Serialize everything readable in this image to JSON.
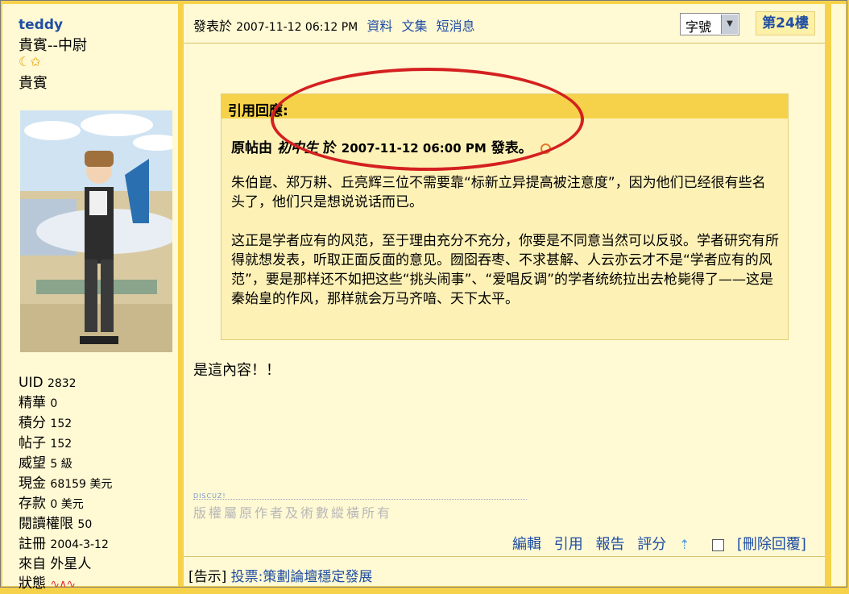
{
  "user": {
    "name": "teddy",
    "rank": "貴賓--中尉",
    "rank_icons": "☾✩",
    "group": "貴賓",
    "stats": [
      {
        "label": "UID",
        "value": "2832"
      },
      {
        "label": "精華",
        "value": "0"
      },
      {
        "label": "積分",
        "value": "152"
      },
      {
        "label": "帖子",
        "value": "152"
      },
      {
        "label": "威望",
        "value": "5 級"
      },
      {
        "label": "現金",
        "value": "68159 美元"
      },
      {
        "label": "存款",
        "value": "0 美元"
      },
      {
        "label": "閱讀權限",
        "value": "50"
      },
      {
        "label": "註冊",
        "value": "2004-3-12"
      },
      {
        "label": "來自",
        "value": "外星人"
      },
      {
        "label": "狀態",
        "value": ""
      }
    ]
  },
  "post": {
    "meta_prefix": "發表於",
    "date": "2007-11-12 06:12 PM",
    "links": [
      "資料",
      "文集",
      "短消息"
    ],
    "font_select": "字號",
    "floor": "第24樓",
    "quote": {
      "title": "引用回應:",
      "source_prefix": "原帖由",
      "source_user": "初中生",
      "source_mid": "於",
      "source_date": "2007-11-12 06:00 PM",
      "source_suffix": "發表。",
      "paragraph1": "朱伯崑、郑万耕、丘亮辉三位不需要靠“标新立异提高被注意度”，因为他们已经很有些名头了，他们只是想说说话而已。",
      "paragraph2": "这正是学者应有的风范，至于理由充分不充分，你要是不同意当然可以反驳。学者研究有所得就想发表，听取正面反面的意见。囫囵吞枣、不求甚解、人云亦云才不是“学者应有的风范”，要是那样还不如把这些“挑头闹事”、“爱唱反调”的学者统统拉出去枪毙得了——这是秦始皇的作风，那样就会万马齐喑、天下太平。"
    },
    "reply": "是這內容！！",
    "discuz_tag": "DISCUZ!",
    "copyright": "版權屬原作者及術數縱橫所有",
    "actions": [
      "編輯",
      "引用",
      "報告",
      "評分"
    ],
    "delete_label": "[刪除回覆]"
  },
  "footer": {
    "prefix": "[告示]",
    "link": "投票:策劃論壇穩定發展"
  },
  "colors": {
    "frame": "#f6d24a",
    "panel": "#fff9d4",
    "link": "#1f4ea3",
    "annotation": "#d42020"
  }
}
